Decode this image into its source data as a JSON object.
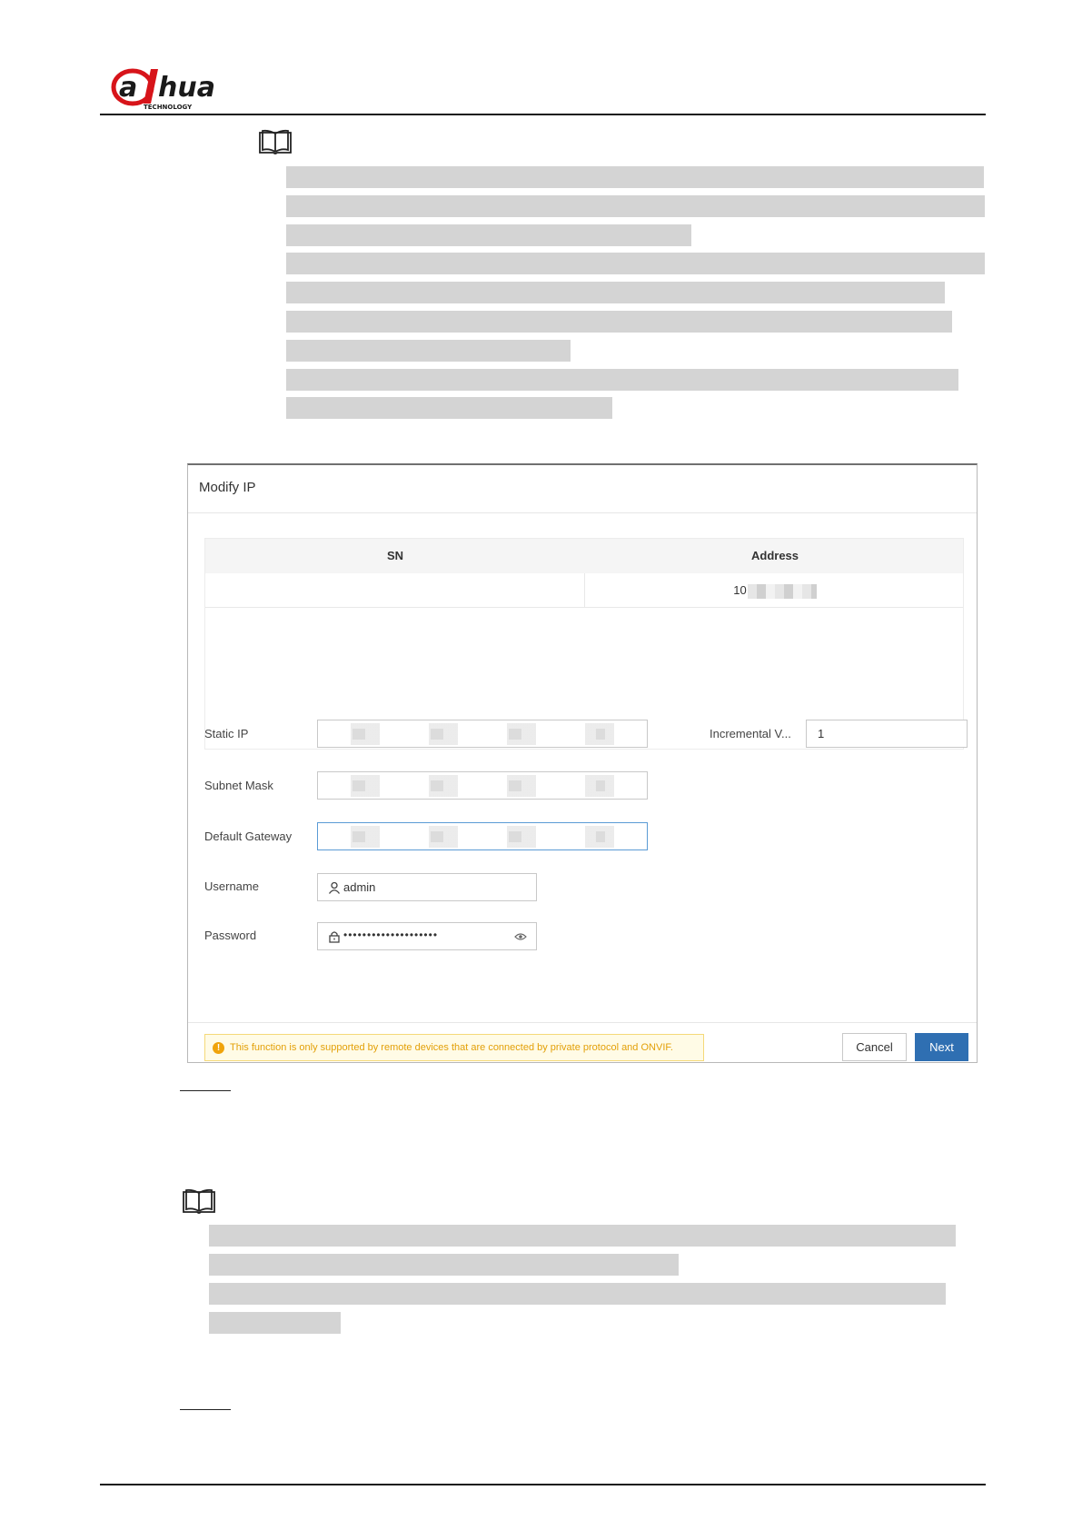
{
  "brand": {
    "logo_text": "alhua",
    "logo_subtext": "TECHNOLOGY"
  },
  "dialog": {
    "title": "Modify IP",
    "table": {
      "columns": [
        "SN",
        "Address"
      ],
      "rows": [
        {
          "sn": "",
          "address": "10"
        }
      ]
    },
    "fields": {
      "static_ip_label": "Static IP",
      "subnet_mask_label": "Subnet Mask",
      "default_gateway_label": "Default Gateway",
      "incremental_label": "Incremental V...",
      "incremental_value": "1",
      "username_label": "Username",
      "username_value": "admin",
      "password_label": "Password",
      "password_value": "••••••••••••••••••••"
    },
    "warning": "This function is only supported by remote devices that are connected by private protocol and ONVIF.",
    "buttons": {
      "cancel": "Cancel",
      "next": "Next"
    }
  },
  "colors": {
    "primary_button": "#2f6fb2",
    "warning_text": "#e3a008",
    "warning_bg": "#fffbe6",
    "redaction": "#d4d4d4"
  }
}
